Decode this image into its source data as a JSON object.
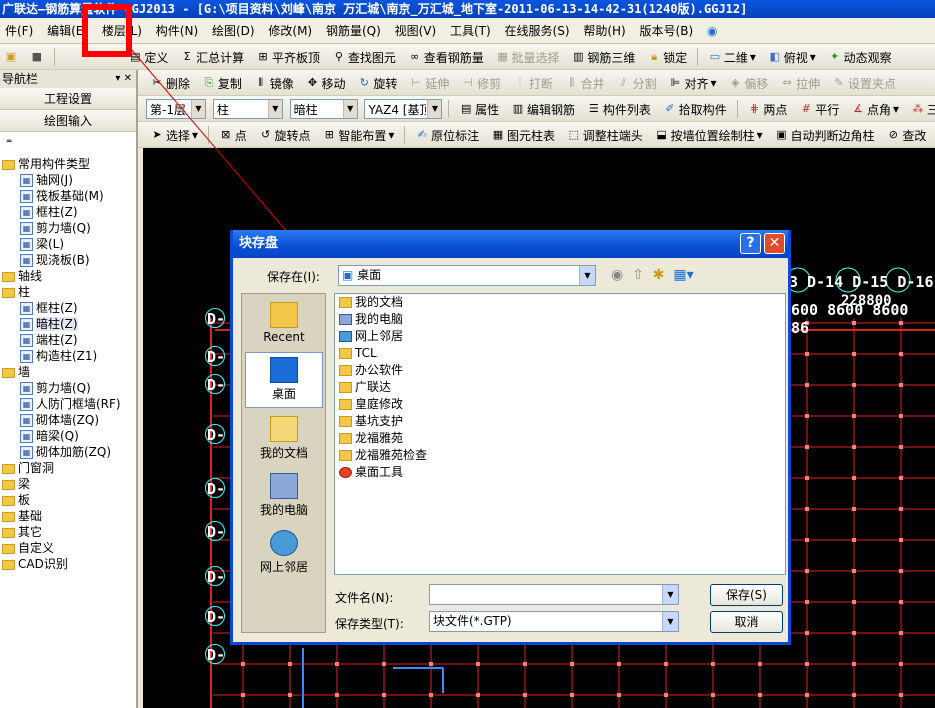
{
  "title": "广联达—钢筋算量软件 GGJ2013 - [G:\\项目资料\\刘峰\\南京 万汇城\\南京_万汇城_地下室-2011-06-13-14-42-31(1240版).GGJ12]",
  "menu": [
    "件(F)",
    "编辑(E)",
    "楼层(L)",
    "构件(N)",
    "绘图(D)",
    "修改(M)",
    "钢筋量(Q)",
    "视图(V)",
    "工具(T)",
    "在线服务(S)",
    "帮助(H)",
    "版本号(B)"
  ],
  "toolbar1": {
    "items": [
      "定义",
      "汇总计算",
      "平齐板顶",
      "查找图元",
      "查看钢筋量",
      "批量选择",
      "钢筋三维",
      "锁定",
      "二维",
      "俯视",
      "动态观察"
    ]
  },
  "toolbar2": {
    "items": [
      "删除",
      "复制",
      "镜像",
      "移动",
      "旋转",
      "延伸",
      "修剪",
      "打断",
      "合并",
      "分割",
      "对齐",
      "偏移",
      "拉伸",
      "设置夹点"
    ]
  },
  "toolbar3": {
    "floor": "第-1层",
    "type": "柱",
    "subtype": "暗柱",
    "component": "YAZ4 [基顶",
    "items": [
      "属性",
      "编辑钢筋",
      "构件列表",
      "拾取构件",
      "两点",
      "平行",
      "点角",
      "三点"
    ]
  },
  "toolbar4": {
    "items": [
      "选择",
      "点",
      "旋转点",
      "智能布置",
      "原位标注",
      "图元柱表",
      "调整柱端头",
      "按墙位置绘制柱",
      "自动判断边角柱",
      "查改"
    ]
  },
  "nav": {
    "title": "导航栏",
    "buttons": [
      "工程设置",
      "绘图输入"
    ],
    "tree": [
      {
        "label": "常用构件类型",
        "level": 0,
        "folder": true
      },
      {
        "label": "轴网(J)",
        "level": 1
      },
      {
        "label": "筏板基础(M)",
        "level": 1
      },
      {
        "label": "框柱(Z)",
        "level": 1
      },
      {
        "label": "剪力墙(Q)",
        "level": 1
      },
      {
        "label": "梁(L)",
        "level": 1
      },
      {
        "label": "现浇板(B)",
        "level": 1
      },
      {
        "label": "轴线",
        "level": 0,
        "folder": true
      },
      {
        "label": "柱",
        "level": 0,
        "folder": true
      },
      {
        "label": "框柱(Z)",
        "level": 1
      },
      {
        "label": "暗柱(Z)",
        "level": 1
      },
      {
        "label": "端柱(Z)",
        "level": 1
      },
      {
        "label": "构造柱(Z1)",
        "level": 1
      },
      {
        "label": "墙",
        "level": 0,
        "folder": true
      },
      {
        "label": "剪力墙(Q)",
        "level": 1
      },
      {
        "label": "人防门框墙(RF)",
        "level": 1
      },
      {
        "label": "砌体墙(ZQ)",
        "level": 1
      },
      {
        "label": "暗梁(Q)",
        "level": 1
      },
      {
        "label": "砌体加筋(ZQ)",
        "level": 1
      },
      {
        "label": "门窗洞",
        "level": 0,
        "folder": true
      },
      {
        "label": "梁",
        "level": 0,
        "folder": true
      },
      {
        "label": "板",
        "level": 0,
        "folder": true
      },
      {
        "label": "基础",
        "level": 0,
        "folder": true
      },
      {
        "label": "其它",
        "level": 0,
        "folder": true
      },
      {
        "label": "自定义",
        "level": 0,
        "folder": true
      },
      {
        "label": "CAD识别",
        "level": 0,
        "folder": true
      }
    ]
  },
  "canvas": {
    "top_labels": "3 D-14 D-15 D-16",
    "dim_total": "228800",
    "dim_spans": "600 8600 8600 86",
    "left_labels": [
      "D-",
      "D-",
      "D-",
      "D-",
      "D-",
      "D-",
      "D-",
      "D-",
      "D-"
    ]
  },
  "dialog": {
    "title": "块存盘",
    "save_in_label": "保存在(I):",
    "save_in_value": "桌面",
    "places": [
      "Recent",
      "桌面",
      "我的文档",
      "我的电脑",
      "网上邻居"
    ],
    "files": [
      "我的文档",
      "我的电脑",
      "网上邻居",
      "TCL",
      "办公软件",
      "广联达",
      "皇庭修改",
      "基坑支护",
      "龙福雅苑",
      "龙福雅苑检查",
      "桌面工具"
    ],
    "filename_label": "文件名(N):",
    "filename_value": "",
    "filetype_label": "保存类型(T):",
    "filetype_value": "块文件(*.GTP)",
    "save_button": "保存(S)",
    "cancel_button": "取消"
  }
}
